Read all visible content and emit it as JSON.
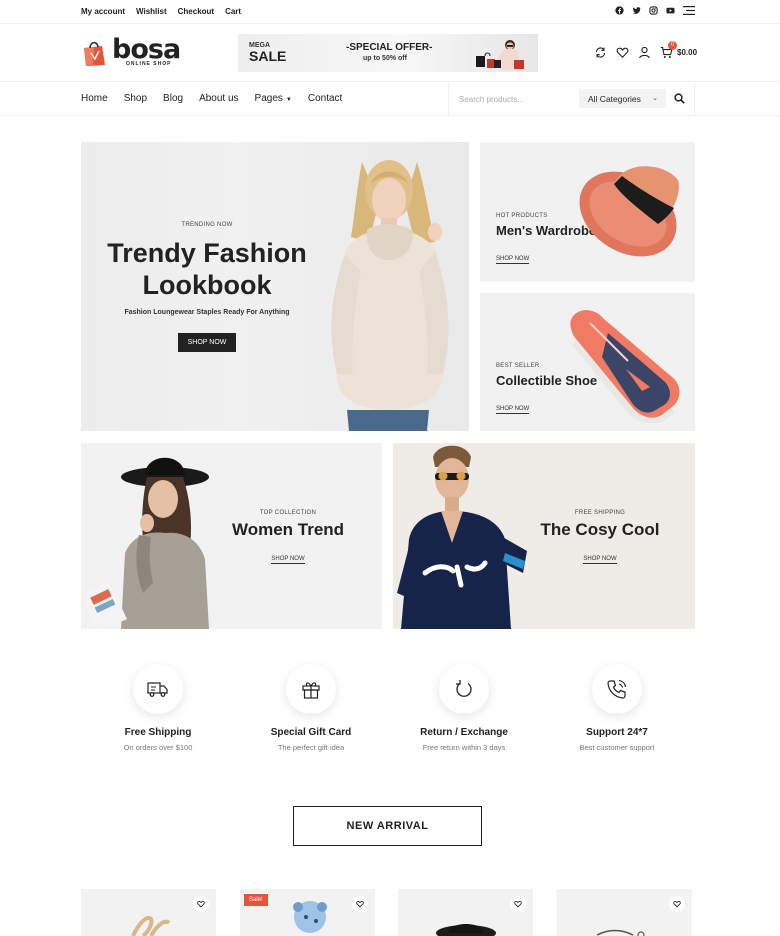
{
  "topbar": {
    "links": [
      "My account",
      "Wishlist",
      "Checkout",
      "Cart"
    ],
    "social_icons": [
      "facebook-icon",
      "twitter-icon",
      "instagram-icon",
      "youtube-icon",
      "menu-icon"
    ]
  },
  "header": {
    "logo_text": "bosa",
    "logo_subtitle": "ONLINE SHOP",
    "banner": {
      "mega": "MEGA",
      "sale": "SALE",
      "offer": "-SPECIAL OFFER-",
      "upto": "up to 50% off"
    },
    "cart_count": "0",
    "cart_total": "$0.00",
    "icons": [
      "compare-icon",
      "heart-icon",
      "user-icon",
      "cart-icon"
    ]
  },
  "nav": {
    "items": [
      "Home",
      "Shop",
      "Blog",
      "About us",
      "Pages",
      "Contact"
    ],
    "search_placeholder": "Search products...",
    "category_selected": "All Categories"
  },
  "hero": {
    "eyebrow": "TRENDING NOW",
    "title_line1": "Trendy Fashion",
    "title_line2": "Lookbook",
    "subtitle": "Fashion Loungewear Staples Ready For Anything",
    "button": "SHOP NOW"
  },
  "promos": [
    {
      "eyebrow": "HOT PRODUCTS",
      "title": "Men's Wardrobe",
      "link": "SHOP NOW"
    },
    {
      "eyebrow": "BEST SELLER",
      "title": "Collectible Shoe",
      "link": "SHOP NOW"
    },
    {
      "eyebrow": "TOP COLLECTION",
      "title": "Women Trend",
      "link": "SHOP NOW"
    },
    {
      "eyebrow": "FREE SHIPPING",
      "title": "The Cosy Cool",
      "link": "SHOP NOW"
    }
  ],
  "features": [
    {
      "icon": "truck-icon",
      "title": "Free Shipping",
      "subtitle": "On orders over $100"
    },
    {
      "icon": "gift-icon",
      "title": "Special Gift Card",
      "subtitle": "The perfect gift idea"
    },
    {
      "icon": "return-icon",
      "title": "Return / Exchange",
      "subtitle": "Free return within 3 days"
    },
    {
      "icon": "phone-icon",
      "title": "Support 24*7",
      "subtitle": "Best customer support"
    }
  ],
  "new_arrival": {
    "label": "NEW ARRIVAL"
  },
  "products": [
    {
      "sale": ""
    },
    {
      "sale": "Sale!"
    },
    {
      "sale": ""
    },
    {
      "sale": ""
    }
  ],
  "colors": {
    "accent": "#e8533c",
    "text": "#222222",
    "tile_bg": "#f1f1f1"
  }
}
